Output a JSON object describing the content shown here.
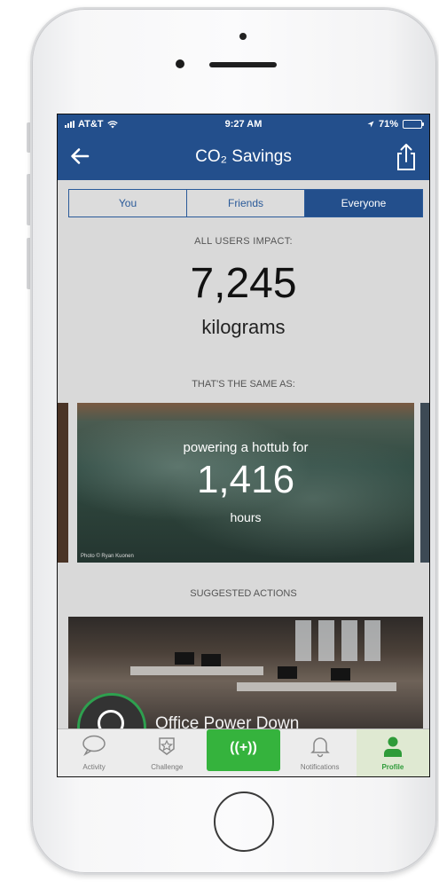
{
  "status_bar": {
    "carrier": "AT&T",
    "time": "9:27 AM",
    "battery_percent": "71%",
    "battery_level": 0.71
  },
  "nav": {
    "title": "CO₂ Savings",
    "back_icon": "arrow-left-icon",
    "share_icon": "share-icon"
  },
  "segments": {
    "items": [
      {
        "label": "You"
      },
      {
        "label": "Friends"
      },
      {
        "label": "Everyone"
      }
    ],
    "selected": "Everyone"
  },
  "impact": {
    "label": "ALL USERS IMPACT:",
    "value": "7,245",
    "unit": "kilograms"
  },
  "equivalent": {
    "label": "THAT'S THE SAME AS:",
    "text": "powering a hottub for",
    "value": "1,416",
    "unit": "hours",
    "photo_credit": "Photo © Ryan Kuonen"
  },
  "suggested": {
    "label": "SUGGESTED ACTIONS",
    "action_title": "Office Power Down"
  },
  "tabs": [
    {
      "label": "Activity",
      "icon": "chat-bubble-icon"
    },
    {
      "label": "Challenge",
      "icon": "star-badge-icon"
    },
    {
      "label": "",
      "icon": "broadcast-plus-icon",
      "glyph": "((+))"
    },
    {
      "label": "Notifications",
      "icon": "bell-icon"
    },
    {
      "label": "Profile",
      "icon": "person-icon"
    }
  ],
  "colors": {
    "brand_blue": "#234f8c",
    "accent_green": "#35b33d"
  }
}
